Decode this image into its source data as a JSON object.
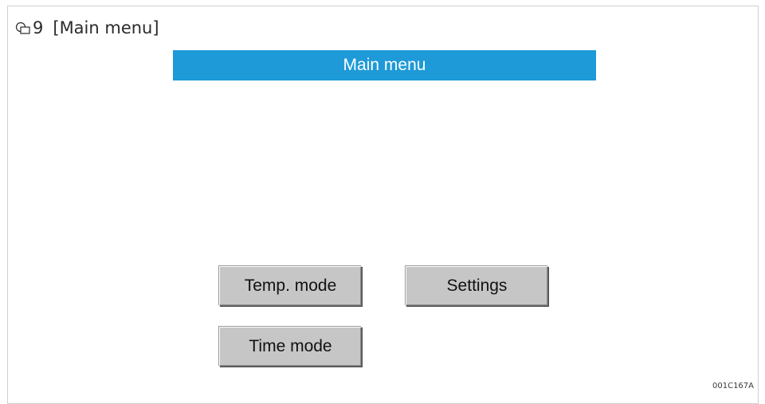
{
  "caption": {
    "icon": "figure-icon",
    "number": "9",
    "title": "[Main menu]"
  },
  "screen": {
    "title": "Main menu",
    "title_bar_color": "#1e9ad8",
    "buttons": {
      "temp_mode": "Temp. mode",
      "settings": "Settings",
      "time_mode": "Time mode"
    }
  },
  "figure_code": "001C167A"
}
